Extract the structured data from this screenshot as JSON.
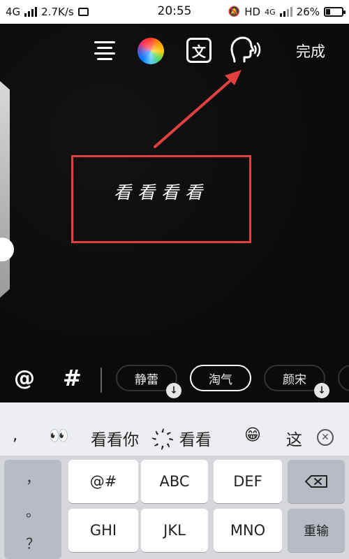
{
  "status_bar": {
    "network": "4G",
    "speed": "2.7K/s",
    "time": "20:55",
    "hd": "HD",
    "network2": "4G",
    "battery": "26%",
    "battery_level": 0.26
  },
  "toolbar": {
    "menu_icon": "menu-icon",
    "color_icon": "color-wheel-icon",
    "text_icon_label": "文",
    "voice_icon": "voice-reading-icon",
    "done_label": "完成"
  },
  "canvas": {
    "caption": "看看看看",
    "accent_color": "#e0413f"
  },
  "font_row": {
    "at_label": "@",
    "hash_label": "#",
    "fonts": [
      {
        "label": "静蕾",
        "downloadable": true
      },
      {
        "label": "淘气",
        "selected": true
      },
      {
        "label": "颜宋",
        "downloadable": true
      }
    ]
  },
  "keyboard": {
    "candidates": [
      ",",
      "👀",
      "看看你",
      "҉ 看看",
      "😁",
      "这"
    ],
    "punctuation": [
      "，",
      "。",
      "？"
    ],
    "row1": [
      "@#",
      "ABC",
      "DEF"
    ],
    "row2": [
      "GHI",
      "JKL",
      "MNO"
    ],
    "reinput_label": "重输"
  }
}
